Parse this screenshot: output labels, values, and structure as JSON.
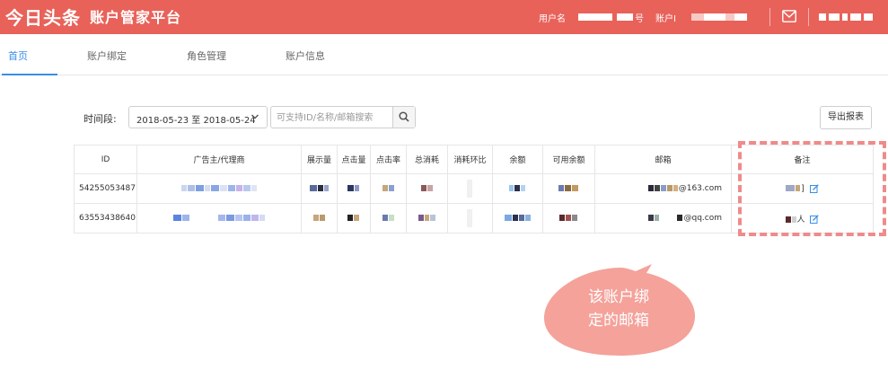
{
  "header": {
    "brand": "今日头条",
    "platform_title": "账户管家平台",
    "username_label": "用户名",
    "account_label_prefix": "号",
    "account_id_label": "账户I"
  },
  "tabs": [
    {
      "label": "首页",
      "active": true
    },
    {
      "label": "账户绑定",
      "active": false
    },
    {
      "label": "角色管理",
      "active": false
    },
    {
      "label": "账户信息",
      "active": false
    }
  ],
  "filters": {
    "period_label": "时间段:",
    "date_range": "2018-05-23 至 2018-05-24",
    "search_placeholder": "可支持ID/名称/邮箱搜索",
    "export_label": "导出报表"
  },
  "table": {
    "columns": [
      "ID",
      "广告主/代理商",
      "展示量",
      "点击量",
      "点击率",
      "总消耗",
      "消耗环比",
      "余额",
      "可用余额",
      "邮箱",
      "备注"
    ],
    "rows": [
      {
        "id": "54255053487",
        "email_suffix": "@163.com",
        "note_suffix": "]"
      },
      {
        "id": "63553438640",
        "email_suffix": "@qq.com",
        "note_suffix": "人"
      }
    ]
  },
  "callout": {
    "line1": "该账户绑",
    "line2": "定的邮箱"
  },
  "colors": {
    "header_bg": "#e8625a",
    "active_tab": "#3a8ee6",
    "highlight": "#ef8b8b",
    "callout_fill": "#f4a29a"
  }
}
